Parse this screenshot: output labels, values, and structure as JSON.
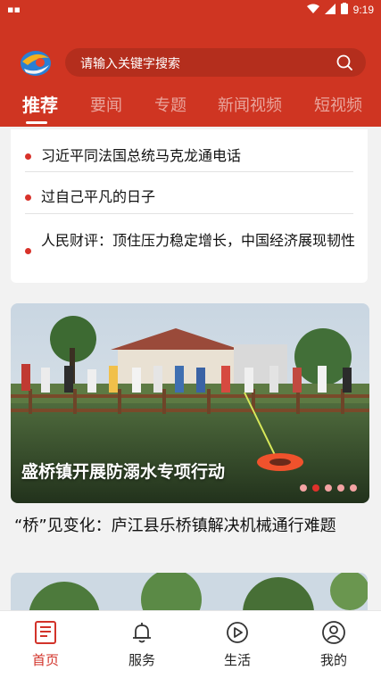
{
  "status_bar": {
    "left_icon": "sim-icon",
    "time": "9:19"
  },
  "header": {
    "search": {
      "placeholder": "请输入关键字搜索"
    }
  },
  "tabs": [
    {
      "label": "推荐",
      "active": true
    },
    {
      "label": "要闻"
    },
    {
      "label": "专题"
    },
    {
      "label": "新闻视频"
    },
    {
      "label": "短视频"
    }
  ],
  "headlines": [
    {
      "title": "习近平同法国总统马克龙通电话"
    },
    {
      "title": "过自己平凡的日子"
    },
    {
      "title": "人民财评：顶住压力稳定增长，中国经济展现韧性"
    }
  ],
  "banner": {
    "caption": "盛桥镇开展防溺水专项行动",
    "slide_count": 5,
    "active_slide": 2
  },
  "articles": [
    {
      "title": "“桥”见变化：庐江县乐桥镇解决机械通行难题"
    }
  ],
  "bottom_nav": [
    {
      "label": "首页",
      "icon": "home-news-icon",
      "active": true
    },
    {
      "label": "服务",
      "icon": "bell-icon"
    },
    {
      "label": "生活",
      "icon": "play-circle-icon"
    },
    {
      "label": "我的",
      "icon": "user-icon"
    }
  ],
  "colors": {
    "brand_red": "#cf3522",
    "accent_red": "#d8322a"
  }
}
